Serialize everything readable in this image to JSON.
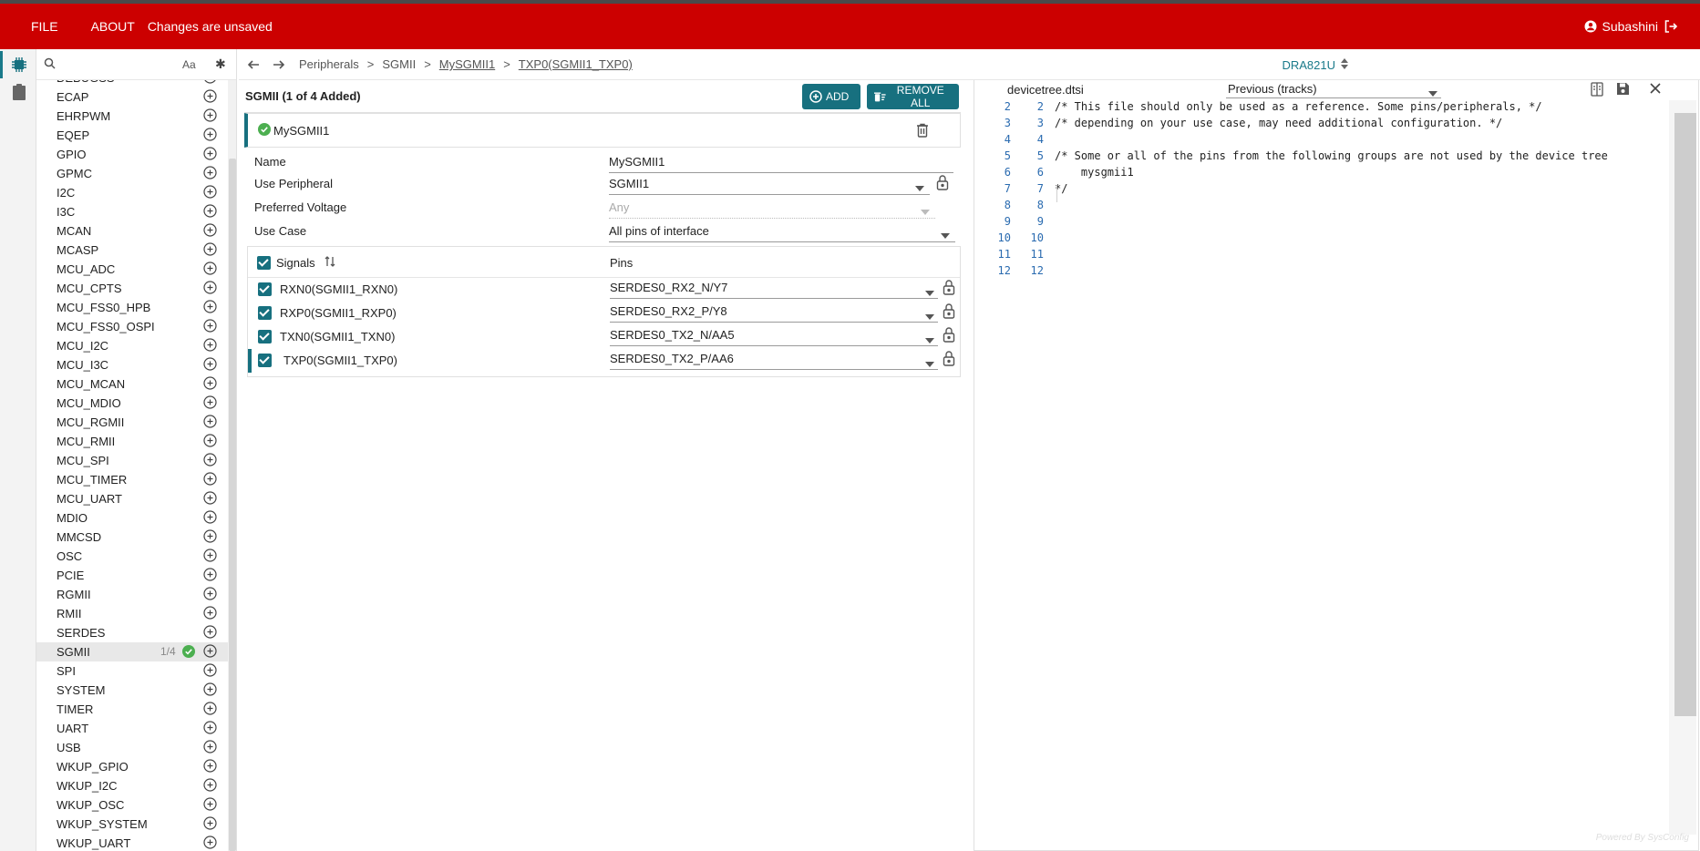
{
  "topbar": {
    "file": "FILE",
    "about": "ABOUT",
    "status": "Changes are unsaved",
    "user": "Subashini"
  },
  "sidebar": {
    "search": {
      "value": "",
      "placeholder": ""
    },
    "case_label": "Aa",
    "filter_glyph": "✱",
    "items": [
      {
        "label": "DEBUGSS"
      },
      {
        "label": "ECAP"
      },
      {
        "label": "EHRPWM"
      },
      {
        "label": "EQEP"
      },
      {
        "label": "GPIO"
      },
      {
        "label": "GPMC"
      },
      {
        "label": "I2C"
      },
      {
        "label": "I3C"
      },
      {
        "label": "MCAN"
      },
      {
        "label": "MCASP"
      },
      {
        "label": "MCU_ADC"
      },
      {
        "label": "MCU_CPTS"
      },
      {
        "label": "MCU_FSS0_HPB"
      },
      {
        "label": "MCU_FSS0_OSPI"
      },
      {
        "label": "MCU_I2C"
      },
      {
        "label": "MCU_I3C"
      },
      {
        "label": "MCU_MCAN"
      },
      {
        "label": "MCU_MDIO"
      },
      {
        "label": "MCU_RGMII"
      },
      {
        "label": "MCU_RMII"
      },
      {
        "label": "MCU_SPI"
      },
      {
        "label": "MCU_TIMER"
      },
      {
        "label": "MCU_UART"
      },
      {
        "label": "MDIO"
      },
      {
        "label": "MMCSD"
      },
      {
        "label": "OSC"
      },
      {
        "label": "PCIE"
      },
      {
        "label": "RGMII"
      },
      {
        "label": "RMII"
      },
      {
        "label": "SERDES"
      },
      {
        "label": "SGMII",
        "count": "1/4",
        "selected": true
      },
      {
        "label": "SPI"
      },
      {
        "label": "SYSTEM"
      },
      {
        "label": "TIMER"
      },
      {
        "label": "UART"
      },
      {
        "label": "USB"
      },
      {
        "label": "WKUP_GPIO"
      },
      {
        "label": "WKUP_I2C"
      },
      {
        "label": "WKUP_OSC"
      },
      {
        "label": "WKUP_SYSTEM"
      },
      {
        "label": "WKUP_UART"
      }
    ]
  },
  "breadcrumb": {
    "items": [
      "Peripherals",
      "SGMII",
      "MySGMII1",
      "TXP0(SGMII1_TXP0)"
    ],
    "separator": ">",
    "device": "DRA821U"
  },
  "config": {
    "title": "SGMII (1 of 4 Added)",
    "add_label": "ADD",
    "remove_all_label": "REMOVE ALL",
    "instance_name": "MySGMII1",
    "fields": {
      "name": {
        "label": "Name",
        "value": "MySGMII1"
      },
      "use_peripheral": {
        "label": "Use Peripheral",
        "value": "SGMII1"
      },
      "preferred_voltage": {
        "label": "Preferred Voltage",
        "value": "Any"
      },
      "use_case": {
        "label": "Use Case",
        "value": "All pins of interface"
      }
    },
    "signals_header": "Signals",
    "pins_header": "Pins",
    "signals": [
      {
        "name": "RXN0(SGMII1_RXN0)",
        "pin": "SERDES0_RX2_N/Y7"
      },
      {
        "name": "RXP0(SGMII1_RXP0)",
        "pin": "SERDES0_RX2_P/Y8"
      },
      {
        "name": "TXN0(SGMII1_TXN0)",
        "pin": "SERDES0_TX2_N/AA5"
      },
      {
        "name": "TXP0(SGMII1_TXP0)",
        "pin": "SERDES0_TX2_P/AA6"
      }
    ]
  },
  "code": {
    "filename": "devicetree.dtsi",
    "compare": "Previous (tracks)",
    "lines": [
      {
        "a": "2",
        "b": "2",
        "text": "/* This file should only be used as a reference. Some pins/peripherals, */"
      },
      {
        "a": "3",
        "b": "3",
        "text": "/* depending on your use case, may need additional configuration. */"
      },
      {
        "a": "4",
        "b": "4",
        "text": ""
      },
      {
        "a": "5",
        "b": "5",
        "text": "/* Some or all of the pins from the following groups are not used by the device tree"
      },
      {
        "a": "6",
        "b": "6",
        "text": "    mysgmii1"
      },
      {
        "a": "7",
        "b": "7",
        "text": "*/"
      },
      {
        "a": "8",
        "b": "8",
        "text": ""
      },
      {
        "a": "9",
        "b": "9",
        "text": ""
      },
      {
        "a": "10",
        "b": "10",
        "text": ""
      },
      {
        "a": "11",
        "b": "11",
        "text": ""
      },
      {
        "a": "12",
        "b": "12",
        "text": ""
      }
    ],
    "powered": "Powered By SysConfig"
  },
  "colors": {
    "brand": "#cc0000",
    "accent": "#17707f",
    "ok": "#4caf50"
  }
}
